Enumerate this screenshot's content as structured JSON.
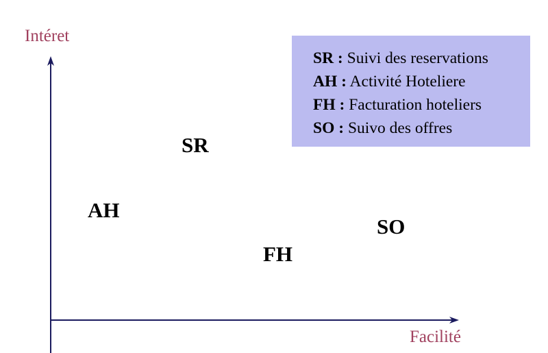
{
  "axes": {
    "y_title": "Intéret",
    "x_title": "Facilité"
  },
  "points": [
    {
      "code": "SR"
    },
    {
      "code": "AH"
    },
    {
      "code": "FH"
    },
    {
      "code": "SO"
    }
  ],
  "legend": {
    "items": [
      {
        "code": "SR :",
        "text": "Suivi des reservations"
      },
      {
        "code": "AH :",
        "text": "Activité Hoteliere"
      },
      {
        "code": "FH :",
        "text": "Facturation hoteliers"
      },
      {
        "code": "SO :",
        "text": "Suivo des offres"
      }
    ]
  },
  "colors": {
    "axis": "#1a1a5e",
    "axis_title": "#a0405e",
    "legend_bg": "#bbbbf0",
    "text": "#000000"
  }
}
